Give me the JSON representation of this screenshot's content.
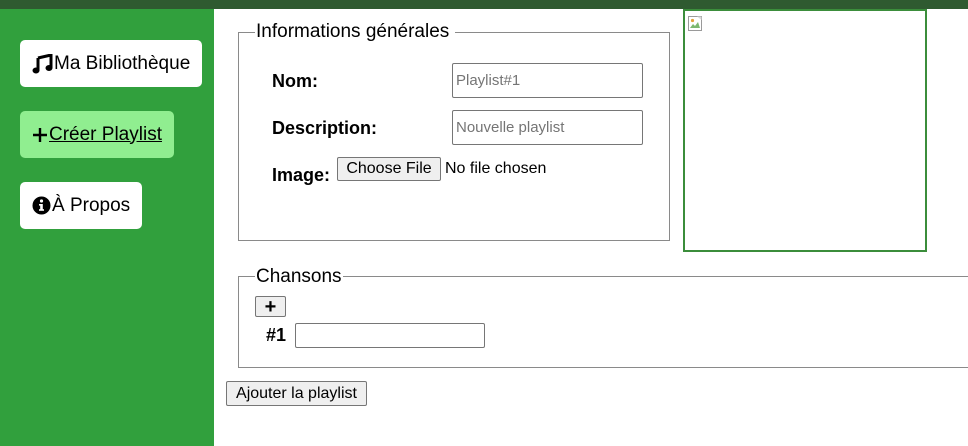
{
  "sidebar": {
    "items": [
      {
        "label": "Ma Bibliothèque",
        "icon": "music-note-icon",
        "active": false
      },
      {
        "label": "Créer Playlist",
        "icon": "plus-icon",
        "active": true
      },
      {
        "label": "À Propos",
        "icon": "info-circle-icon",
        "active": false
      }
    ]
  },
  "info_section": {
    "legend": "Informations générales",
    "name_label": "Nom:",
    "name_placeholder": "Playlist#1",
    "description_label": "Description:",
    "description_placeholder": "Nouvelle playlist",
    "image_label": "Image:",
    "choose_file_label": "Choose File",
    "file_status": "No file chosen"
  },
  "songs_section": {
    "legend": "Chansons",
    "add_button_label": "+",
    "songs": [
      {
        "number": "#1",
        "value": ""
      }
    ]
  },
  "submit_label": "Ajouter la playlist",
  "colors": {
    "sidebar": "#31a03d",
    "topbar": "#2f5a30",
    "active_nav": "#90ee90",
    "preview_border": "#3b8d3b"
  }
}
